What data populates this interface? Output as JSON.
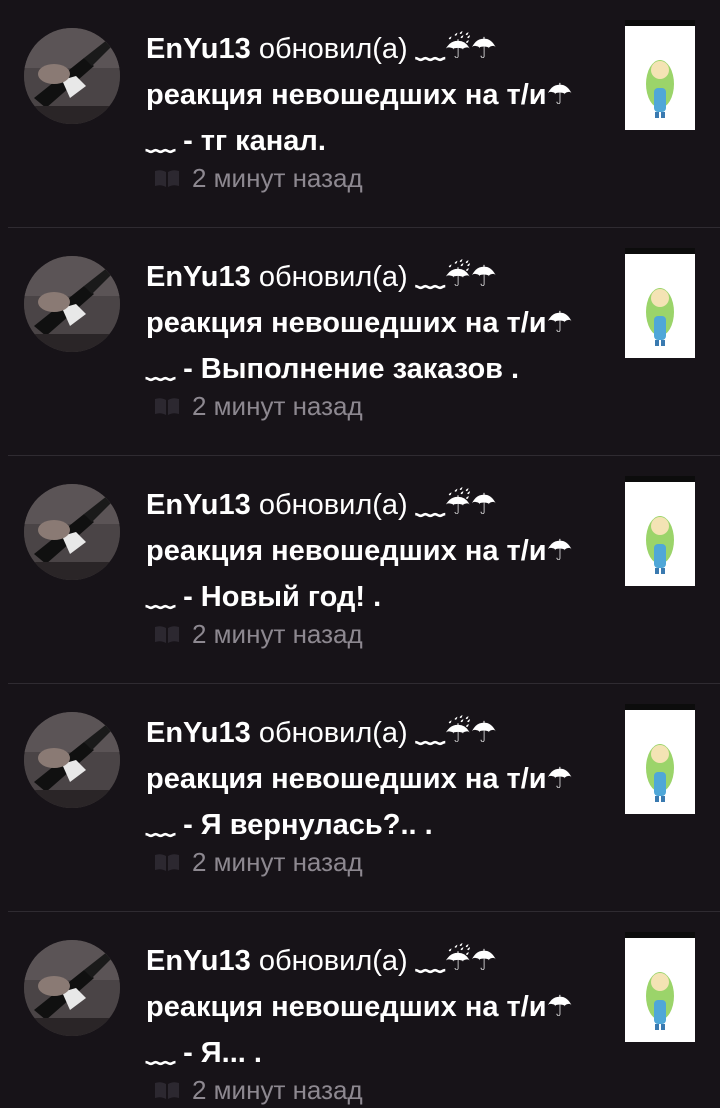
{
  "feed": {
    "items": [
      {
        "author": "EnYu13",
        "action": "обновил(а)",
        "story": "﹏☔︎☂︎ реакция невошедших на т/и☂︎ ﹏",
        "chapter": "- тг канал.",
        "time": "2 минут назад",
        "avatar_icon": "guitar-photo",
        "thumb_icon": "cover-art"
      },
      {
        "author": "EnYu13",
        "action": "обновил(а)",
        "story": "﹏☔︎☂︎ реакция невошедших на т/и☂︎ ﹏",
        "chapter": "- Выполнение заказов .",
        "time": "2 минут назад",
        "avatar_icon": "guitar-photo",
        "thumb_icon": "cover-art"
      },
      {
        "author": "EnYu13",
        "action": "обновил(а)",
        "story": "﹏☔︎☂︎ реакция невошедших на т/и☂︎ ﹏",
        "chapter": "- Новый год! .",
        "time": "2 минут назад",
        "avatar_icon": "guitar-photo",
        "thumb_icon": "cover-art"
      },
      {
        "author": "EnYu13",
        "action": "обновил(а)",
        "story": "﹏☔︎☂︎ реакция невошедших на т/и☂︎ ﹏",
        "chapter": "- Я вернулась?.. .",
        "time": "2 минут назад",
        "avatar_icon": "guitar-photo",
        "thumb_icon": "cover-art"
      },
      {
        "author": "EnYu13",
        "action": "обновил(а)",
        "story": "﹏☔︎☂︎ реакция невошедших на т/и☂︎ ﹏",
        "chapter": "- Я... .",
        "time": "2 минут назад",
        "avatar_icon": "guitar-photo",
        "thumb_icon": "cover-art"
      }
    ]
  },
  "colors": {
    "background": "#171318",
    "text": "#ffffff",
    "muted": "#8d8890",
    "divider": "#2f2b31"
  }
}
